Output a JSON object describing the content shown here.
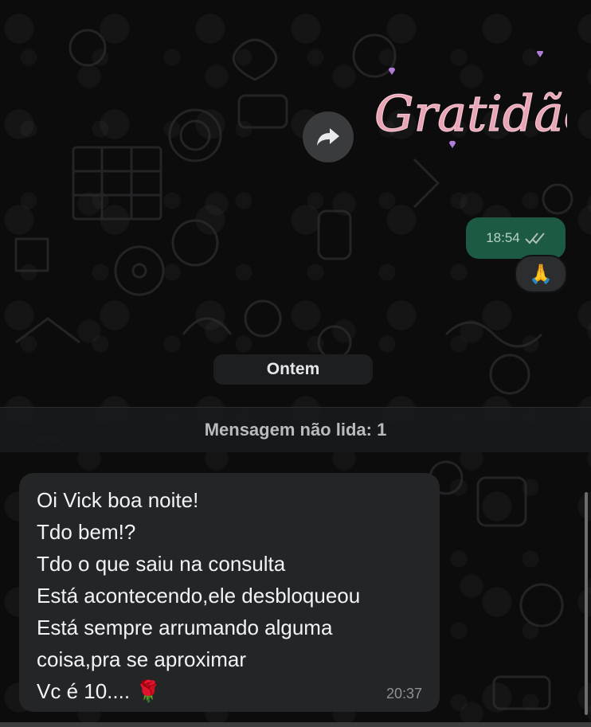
{
  "chat": {
    "sticker": {
      "text": "Gratidão"
    },
    "outgoing": {
      "time": "18:54",
      "status_icon": "double-check-icon",
      "reaction": "🙏"
    },
    "date_chip": "Ontem",
    "unread_banner": "Mensagem não lida: 1",
    "incoming": {
      "lines": [
        "Oi Vick boa noite!",
        "Tdo bem!?",
        "Tdo o que saiu na consulta",
        "Está acontecendo,ele desbloqueou",
        "Está sempre arrumando alguma",
        "coisa,pra se aproximar",
        "Vc é 10...."
      ],
      "emoji": "🌹",
      "time": "20:37"
    }
  },
  "colors": {
    "background": "#0c0c0d",
    "outgoing_bubble": "#1d5a44",
    "incoming_bubble": "#242527",
    "sticker_pink": "#e8a3b4"
  }
}
